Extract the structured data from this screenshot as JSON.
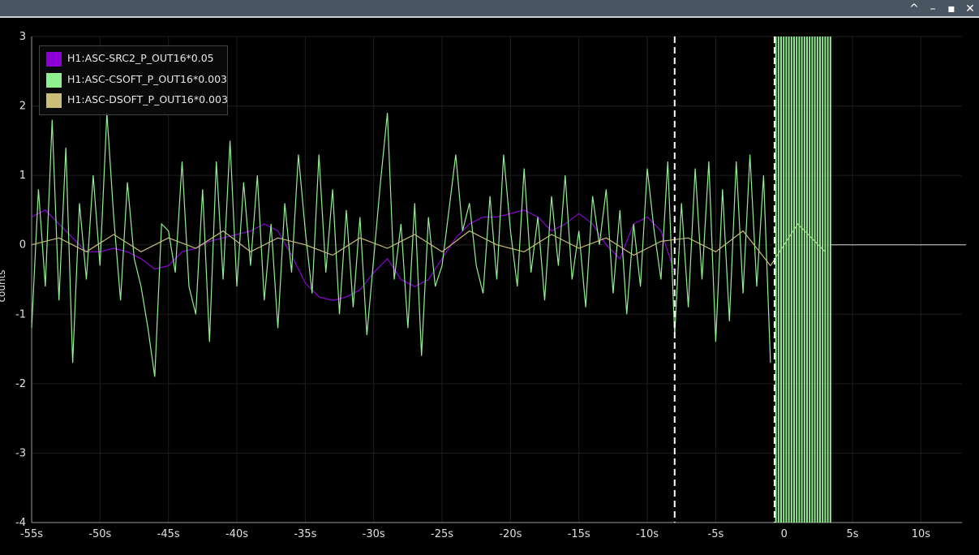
{
  "window": {
    "controls": [
      "^",
      "–",
      "▪",
      "✕"
    ]
  },
  "chart_data": {
    "type": "line",
    "title": "",
    "xlabel": "",
    "ylabel": "counts",
    "xlim": [
      -55,
      13
    ],
    "ylim": [
      -4,
      3
    ],
    "grid": true,
    "legend_position": "top-left",
    "x_ticks": [
      "-55s",
      "-50s",
      "-45s",
      "-40s",
      "-35s",
      "-30s",
      "-25s",
      "-20s",
      "-15s",
      "-10s",
      "-5s",
      "0",
      "5s",
      "10s"
    ],
    "x_tick_values": [
      -55,
      -50,
      -45,
      -40,
      -35,
      -30,
      -25,
      -20,
      -15,
      -10,
      -5,
      0,
      5,
      10
    ],
    "y_ticks": [
      "3",
      "2",
      "1",
      "0",
      "-1",
      "-2",
      "-3",
      "-4"
    ],
    "y_tick_values": [
      3,
      2,
      1,
      0,
      -1,
      -2,
      -3,
      -4
    ],
    "vlines": [
      -8,
      -0.7
    ],
    "data_end_x": 3.4,
    "flat_line_end_x": 13.3,
    "series": [
      {
        "name": "H1:ASC-SRC2_P_OUT16*0.05",
        "color": "#8e00d8",
        "x": [
          -55,
          -54,
          -53,
          -52,
          -51,
          -50,
          -49,
          -48,
          -47,
          -46,
          -45,
          -44,
          -43,
          -42,
          -41,
          -40,
          -39,
          -38,
          -37,
          -36,
          -35,
          -34,
          -33,
          -32,
          -31,
          -30,
          -29,
          -28,
          -27,
          -26,
          -25,
          -24,
          -23,
          -22,
          -21,
          -20,
          -19,
          -18,
          -17,
          -16,
          -15,
          -14,
          -13,
          -12,
          -11,
          -10,
          -9,
          -8
        ],
        "values": [
          0.4,
          0.5,
          0.3,
          0.1,
          -0.1,
          -0.1,
          -0.05,
          -0.1,
          -0.2,
          -0.35,
          -0.3,
          -0.1,
          -0.05,
          0.05,
          0.1,
          0.15,
          0.2,
          0.3,
          0.2,
          -0.15,
          -0.55,
          -0.75,
          -0.8,
          -0.75,
          -0.65,
          -0.4,
          -0.2,
          -0.5,
          -0.6,
          -0.5,
          -0.2,
          0.1,
          0.3,
          0.4,
          0.4,
          0.45,
          0.5,
          0.4,
          0.2,
          0.3,
          0.45,
          0.3,
          0.0,
          -0.2,
          0.3,
          0.4,
          0.2,
          -0.4
        ]
      },
      {
        "name": "H1:ASC-CSOFT_P_OUT16*0.003",
        "color": "#90f090",
        "x": [
          -55,
          -54.5,
          -54,
          -53.5,
          -53,
          -52.5,
          -52,
          -51.5,
          -51,
          -50.5,
          -50,
          -49.5,
          -49,
          -48.5,
          -48,
          -47.5,
          -47,
          -46.5,
          -46,
          -45.5,
          -45,
          -44.5,
          -44,
          -43.5,
          -43,
          -42.5,
          -42,
          -41.5,
          -41,
          -40.5,
          -40,
          -39.5,
          -39,
          -38.5,
          -38,
          -37.5,
          -37,
          -36.5,
          -36,
          -35.5,
          -35,
          -34.5,
          -34,
          -33.5,
          -33,
          -32.5,
          -32,
          -31.5,
          -31,
          -30.5,
          -30,
          -29.5,
          -29,
          -28.5,
          -28,
          -27.5,
          -27,
          -26.5,
          -26,
          -25.5,
          -25,
          -24.5,
          -24,
          -23.5,
          -23,
          -22.5,
          -22,
          -21.5,
          -21,
          -20.5,
          -20,
          -19.5,
          -19,
          -18.5,
          -18,
          -17.5,
          -17,
          -16.5,
          -16,
          -15.5,
          -15,
          -14.5,
          -14,
          -13.5,
          -13,
          -12.5,
          -12,
          -11.5,
          -11,
          -10.5,
          -10,
          -9.5,
          -9,
          -8.5,
          -8,
          -7.5,
          -7,
          -6.5,
          -6,
          -5.5,
          -5,
          -4.5,
          -4,
          -3.5,
          -3,
          -2.5,
          -2,
          -1.5,
          -1
        ],
        "values": [
          -1.2,
          0.8,
          -0.6,
          1.8,
          -0.8,
          1.4,
          -1.7,
          0.6,
          -0.5,
          1.0,
          -0.3,
          1.9,
          0.4,
          -0.8,
          0.9,
          -0.2,
          -0.6,
          -1.2,
          -1.9,
          0.3,
          0.2,
          -0.4,
          1.2,
          -0.6,
          -1.0,
          0.8,
          -1.4,
          1.2,
          -0.5,
          1.5,
          -0.6,
          0.9,
          -0.3,
          1.0,
          -0.8,
          0.3,
          -1.2,
          0.6,
          -0.4,
          1.3,
          0.2,
          -0.7,
          1.3,
          -0.4,
          0.8,
          -1.0,
          0.5,
          -0.9,
          0.4,
          -1.3,
          -0.2,
          0.9,
          1.9,
          -0.5,
          0.3,
          -1.2,
          0.6,
          -1.6,
          0.4,
          -0.6,
          -0.3,
          0.5,
          1.3,
          0.2,
          0.6,
          -0.3,
          -0.7,
          0.7,
          -0.5,
          1.3,
          0.2,
          -0.6,
          1.1,
          -0.4,
          0.4,
          -0.8,
          0.7,
          -0.3,
          1.0,
          -0.5,
          0.2,
          -0.9,
          0.7,
          0.0,
          0.8,
          -0.7,
          0.5,
          -1.0,
          0.3,
          -0.6,
          1.1,
          0.2,
          -0.5,
          1.2,
          -1.3,
          0.6,
          -0.9,
          1.1,
          -0.5,
          1.2,
          -1.4,
          0.8,
          -1.1,
          1.2,
          -0.7,
          1.3,
          -0.6,
          1.0,
          -1.7
        ]
      },
      {
        "name": "H1:ASC-DSOFT_P_OUT16*0.003",
        "color": "#c8be78",
        "x": [
          -55,
          -53,
          -51,
          -49,
          -47,
          -45,
          -43,
          -41,
          -39,
          -37,
          -35,
          -33,
          -31,
          -29,
          -27,
          -25,
          -23,
          -21,
          -19,
          -17,
          -15,
          -13,
          -11,
          -9,
          -7,
          -5,
          -3,
          -1,
          1,
          3
        ],
        "values": [
          0.0,
          0.1,
          -0.1,
          0.15,
          -0.1,
          0.1,
          -0.05,
          0.2,
          -0.1,
          0.1,
          0.0,
          -0.15,
          0.1,
          -0.05,
          0.15,
          -0.1,
          0.2,
          0.0,
          -0.1,
          0.15,
          -0.05,
          0.1,
          -0.15,
          0.05,
          0.1,
          -0.1,
          0.2,
          -0.3,
          0.3,
          -0.1
        ]
      }
    ]
  }
}
